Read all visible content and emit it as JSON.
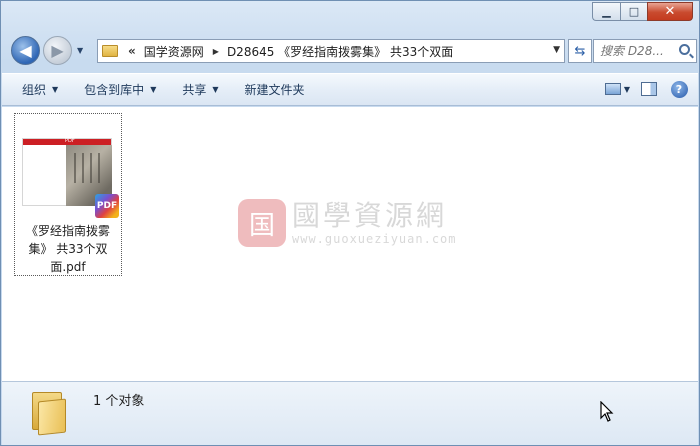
{
  "window": {
    "minimize_glyph": "▁",
    "maximize_glyph": "□",
    "close_glyph": "✕"
  },
  "nav": {
    "back_glyph": "◀",
    "forward_glyph": "▶",
    "recent_glyph": "▼"
  },
  "address": {
    "overflow": "«",
    "crumbs": [
      "国学资源网",
      "D28645 《罗经指南拨雾集》 共33个双面"
    ],
    "sep_glyph": "▶",
    "drop_glyph": "▼"
  },
  "refresh_glyph": "⇆",
  "search": {
    "placeholder": "搜索 D28..."
  },
  "toolbar": {
    "organize": "组织",
    "include_library": "包含到库中",
    "share": "共享",
    "new_folder": "新建文件夹",
    "caret": "▼",
    "help": "?"
  },
  "file": {
    "name": "《罗经指南拨雾集》 共33个双面.pdf",
    "thumb_header": "PDF",
    "badge": "PDF"
  },
  "watermark": {
    "logo_char": "国",
    "cn": "國學資源網",
    "en": "www.guoxueziyuan.com"
  },
  "status": {
    "count_text": "1 个对象"
  },
  "colors": {
    "accent": "#2f66b5",
    "close": "#c43b1f",
    "pdf_red": "#cc1f24"
  }
}
